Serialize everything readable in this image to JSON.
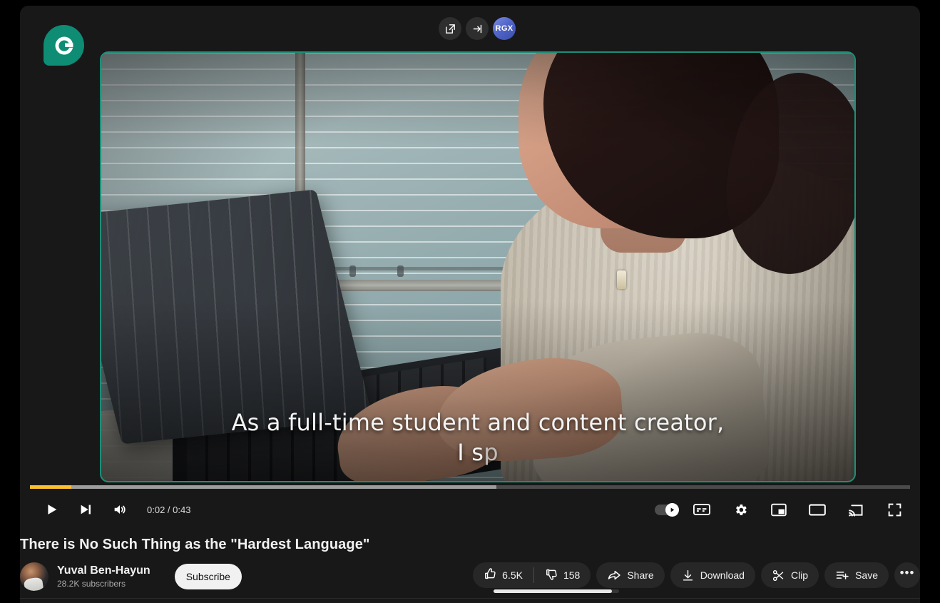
{
  "window": {
    "background": "#000000",
    "panel_background": "#181818"
  },
  "brand": {
    "logo_letter": "G",
    "logo_color": "#0e8c74",
    "name": "grammarly-logo"
  },
  "topbar": {
    "buttons": [
      {
        "name": "open-in-new-window-button",
        "icon": "open-external-icon",
        "label": "Open in new window"
      },
      {
        "name": "sign-in-button",
        "icon": "sign-in-arrow-icon",
        "label": "Sign in"
      }
    ],
    "avatar": {
      "initials": "RGX",
      "name": "user-avatar-rgx",
      "color": "#4f63c9"
    }
  },
  "player": {
    "border_color": "#1a8f77",
    "caption": {
      "line1": "As a full-time student and content creator,",
      "line2_typed": "I s",
      "line2_fading": "p"
    },
    "progress": {
      "played_percent": 4.7,
      "buffered_percent": 53,
      "played_color": "#fbc02d",
      "buffered_color": "#9d9d9d",
      "track_color": "#4a4a4a"
    },
    "time": {
      "current": "0:02",
      "duration": "0:43",
      "display": "0:02 / 0:43"
    },
    "left_controls": [
      {
        "name": "play-button",
        "icon": "play-icon",
        "label": "Play"
      },
      {
        "name": "next-video-button",
        "icon": "next-track-icon",
        "label": "Next"
      },
      {
        "name": "volume-button",
        "icon": "volume-on-icon",
        "label": "Mute"
      }
    ],
    "right_controls": [
      {
        "name": "autoplay-toggle",
        "icon": "autoplay-toggle-icon",
        "label": "Autoplay",
        "state": "on"
      },
      {
        "name": "subtitles-button",
        "icon": "closed-captions-icon",
        "label": "Subtitles/closed captions"
      },
      {
        "name": "settings-button",
        "icon": "gear-icon",
        "label": "Settings"
      },
      {
        "name": "miniplayer-button",
        "icon": "miniplayer-icon",
        "label": "Miniplayer"
      },
      {
        "name": "theater-mode-button",
        "icon": "theater-mode-icon",
        "label": "Theater mode"
      },
      {
        "name": "cast-button",
        "icon": "cast-icon",
        "label": "Play on TV"
      },
      {
        "name": "fullscreen-button",
        "icon": "fullscreen-icon",
        "label": "Full screen"
      }
    ]
  },
  "video": {
    "title": "There is No Such Thing as the \"Hardest Language\""
  },
  "channel": {
    "name": "Yuval Ben-Hayun",
    "subscribers": "28.2K subscribers",
    "subscribe_label": "Subscribe"
  },
  "actions": {
    "like": {
      "label": "6.5K",
      "icon": "thumbs-up-icon"
    },
    "dislike": {
      "label": "158",
      "icon": "thumbs-down-icon"
    },
    "share": {
      "label": "Share",
      "icon": "share-arrow-icon"
    },
    "download": {
      "label": "Download",
      "icon": "download-icon"
    },
    "clip": {
      "label": "Clip",
      "icon": "scissors-icon"
    },
    "save": {
      "label": "Save",
      "icon": "save-to-playlist-icon"
    },
    "more": {
      "label": "•••",
      "icon": "more-actions-icon"
    }
  }
}
